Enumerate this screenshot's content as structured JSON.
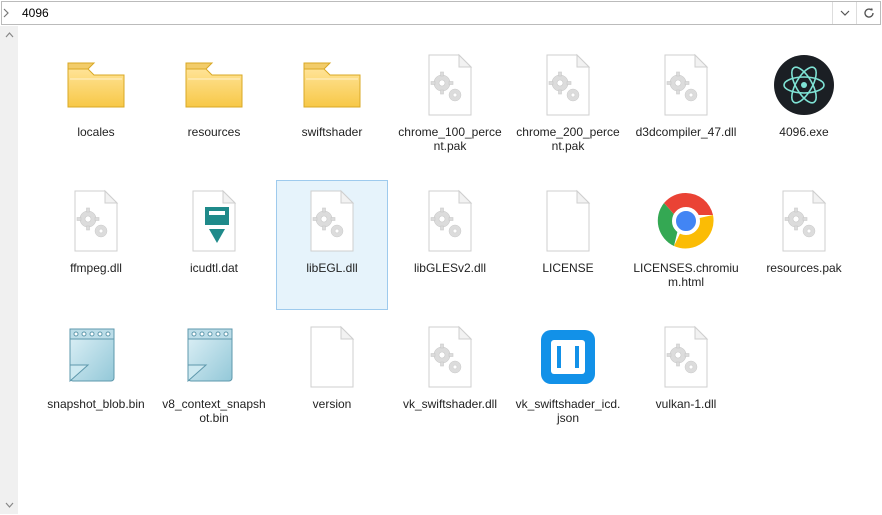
{
  "address_bar": {
    "path": "4096"
  },
  "scrollbar": {
    "thumb_top_pct": 58,
    "thumb_height_pct": 12
  },
  "items": [
    {
      "name": "locales",
      "icon": "folder",
      "selected": false
    },
    {
      "name": "resources",
      "icon": "folder",
      "selected": false
    },
    {
      "name": "swiftshader",
      "icon": "folder",
      "selected": false
    },
    {
      "name": "chrome_100_percent.pak",
      "icon": "gearfile",
      "selected": false
    },
    {
      "name": "chrome_200_percent.pak",
      "icon": "gearfile",
      "selected": false
    },
    {
      "name": "d3dcompiler_47.dll",
      "icon": "gearfile",
      "selected": false
    },
    {
      "name": "4096.exe",
      "icon": "electron",
      "selected": false
    },
    {
      "name": "ffmpeg.dll",
      "icon": "gearfile",
      "selected": false
    },
    {
      "name": "icudtl.dat",
      "icon": "datfile",
      "selected": false
    },
    {
      "name": "libEGL.dll",
      "icon": "gearfile",
      "selected": true
    },
    {
      "name": "libGLESv2.dll",
      "icon": "gearfile",
      "selected": false
    },
    {
      "name": "LICENSE",
      "icon": "blank",
      "selected": false
    },
    {
      "name": "LICENSES.chromium.html",
      "icon": "chrome",
      "selected": false
    },
    {
      "name": "resources.pak",
      "icon": "gearfile",
      "selected": false
    },
    {
      "name": "snapshot_blob.bin",
      "icon": "binfile",
      "selected": false
    },
    {
      "name": "v8_context_snapshot.bin",
      "icon": "binfile",
      "selected": false
    },
    {
      "name": "version",
      "icon": "blank",
      "selected": false
    },
    {
      "name": "vk_swiftshader.dll",
      "icon": "gearfile",
      "selected": false
    },
    {
      "name": "vk_swiftshader_icd.json",
      "icon": "brackets",
      "selected": false
    },
    {
      "name": "vulkan-1.dll",
      "icon": "gearfile",
      "selected": false
    }
  ]
}
